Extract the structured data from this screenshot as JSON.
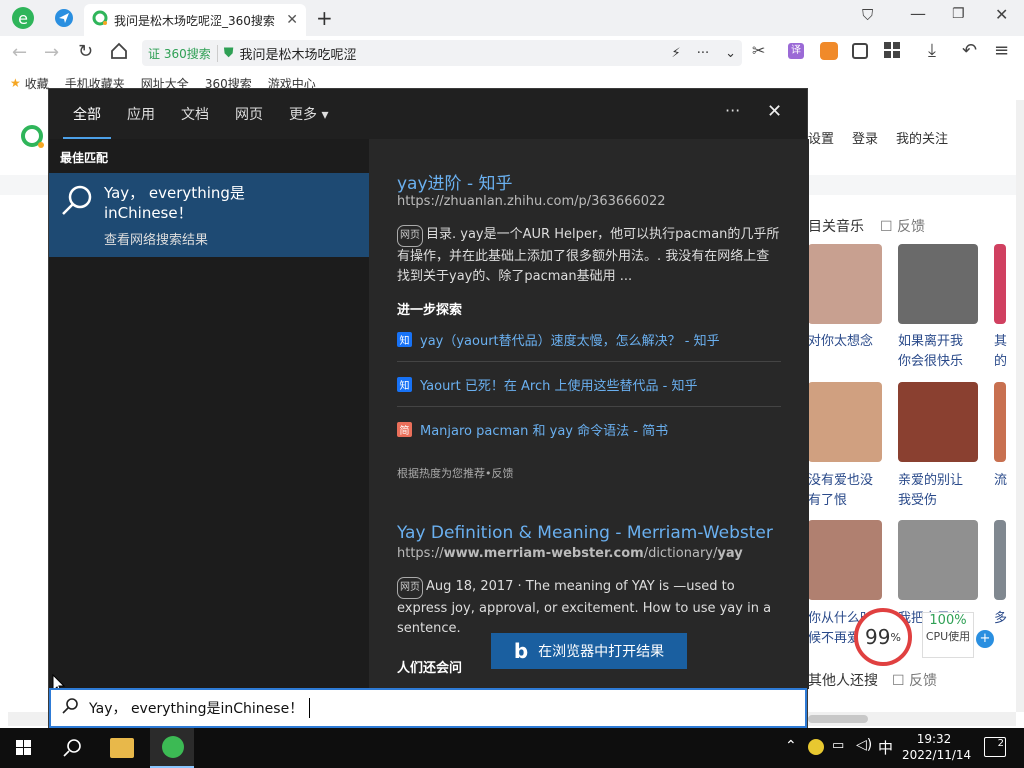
{
  "browser": {
    "tab_title": "我问是松木场吃呢涩_360搜索",
    "address_badge": "证 360搜索",
    "address_text": "我问是松木场吃呢涩",
    "bookmarks": [
      "收藏",
      "手机收藏夹",
      "网址大全",
      "360搜索",
      "游戏中心"
    ]
  },
  "page": {
    "header_links": [
      "设置",
      "登录",
      "我的关注"
    ],
    "music_heading": "目关音乐",
    "feedback": "反馈",
    "feedback2": "反馈",
    "bottom_label": "其他人还搜",
    "captions": [
      [
        "对你太想念",
        "如果离开我",
        "其"
      ],
      [
        "你会很快乐",
        "的"
      ],
      [
        "没有爱也没",
        "亲爱的别让",
        "流"
      ],
      [
        "有了恨",
        "我受伤"
      ],
      [
        "你从什么时",
        "我把自己的"
      ],
      [
        "候不再爱",
        "多"
      ]
    ],
    "thumb_colors": [
      "#c8a090",
      "#6a6a6a",
      "#d04060",
      "#d0a080",
      "#8a4030",
      "#c87050",
      "#b08070",
      "#909090",
      "#808890"
    ]
  },
  "panel": {
    "tabs": [
      "全部",
      "应用",
      "文档",
      "网页",
      "更多"
    ],
    "more_arrow": "▾",
    "best_match_label": "最佳匹配",
    "best_match_title_line1": "Yay，  everything是",
    "best_match_title_line2": "inChinese！",
    "best_match_sub": "查看网络搜索结果",
    "result1": {
      "title": "yay进阶 - 知乎",
      "url": "https://zhuanlan.zhihu.com/p/363666022",
      "badge": "网页",
      "body": "目录. yay是一个AUR Helper，他可以执行pacman的几乎所有操作，并在此基础上添加了很多额外用法。. 我没有在网络上查找到关于yay的、除了pacman基础用 ..."
    },
    "explore_heading": "进一步探索",
    "explore": [
      {
        "icon": "知",
        "color": "#1772f6",
        "text": "yay（yaourt替代品）速度太慢，怎么解决？ - 知乎"
      },
      {
        "icon": "知",
        "color": "#1772f6",
        "text": "Yaourt 已死！在 Arch 上使用这些替代品 - 知乎"
      },
      {
        "icon": "简",
        "color": "#ea6f5a",
        "text": "Manjaro pacman 和 yay 命令语法 - 简书"
      }
    ],
    "recommend_note": "根据热度为您推荐•反馈",
    "result2": {
      "title": "Yay Definition & Meaning - Merriam-Webster",
      "url_prefix": "https://",
      "url_bold": "www.merriam-webster.com",
      "url_mid": "/dictionary/",
      "url_bold2": "yay",
      "badge": "网页",
      "body": "Aug 18, 2017 · The meaning of YAY is —used to express joy, approval, or excitement. How to use yay in a sentence."
    },
    "people_ask": "人们还会问",
    "open_browser": "在浏览器中打开结果",
    "search_value": "Yay，  everything是inChinese！"
  },
  "cpu": {
    "percent": "99",
    "pct_sign": "%",
    "usage": "100%",
    "label": "CPU使用"
  },
  "taskbar": {
    "time": "19:32",
    "date": "2022/11/14",
    "ime": "中",
    "notifications": "2"
  }
}
